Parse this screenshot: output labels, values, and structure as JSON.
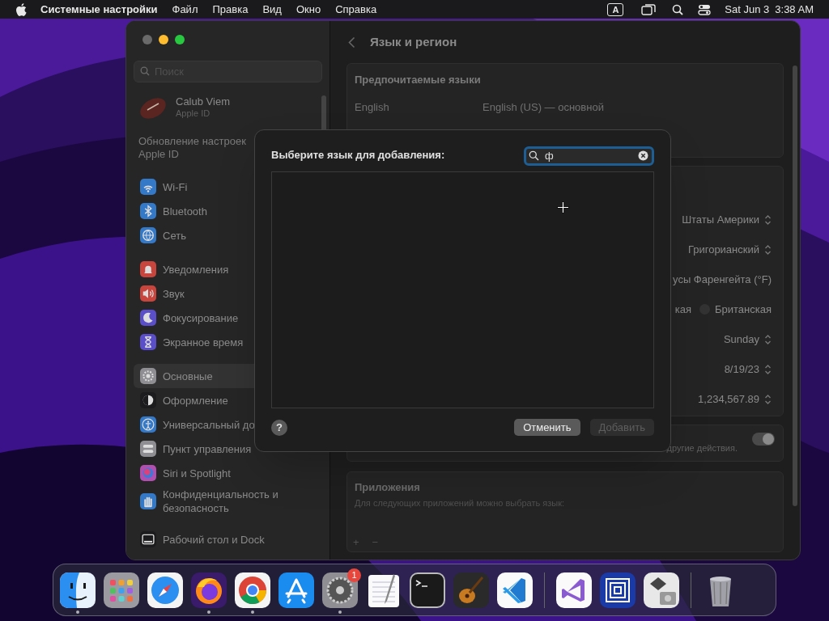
{
  "menu_bar": {
    "app": "Системные настройки",
    "menus": [
      "Файл",
      "Правка",
      "Вид",
      "Окно",
      "Справка"
    ],
    "input_source": "A",
    "date": "Sat Jun 3",
    "time": "3:38 AM"
  },
  "window": {
    "title": "Язык и регион",
    "sidebar": {
      "search": {
        "placeholder": "Поиск"
      },
      "account": {
        "name": "Calub Viem",
        "subtitle": "Apple ID"
      },
      "notice": "Обновление настроек Apple ID",
      "groups": [
        {
          "items": [
            {
              "kind": "wifi",
              "label": "Wi-Fi",
              "color": "#3478c8",
              "selected": false
            },
            {
              "kind": "bluetooth",
              "label": "Bluetooth",
              "color": "#3478c8",
              "selected": false
            },
            {
              "kind": "network",
              "label": "Сеть",
              "color": "#3478c8",
              "selected": false
            }
          ]
        },
        {
          "items": [
            {
              "kind": "bell",
              "label": "Уведомления",
              "color": "#c8453e",
              "selected": false
            },
            {
              "kind": "speaker",
              "label": "Звук",
              "color": "#c8453e",
              "selected": false
            },
            {
              "kind": "moon",
              "label": "Фокусирование",
              "color": "#5a4fc8",
              "selected": false
            },
            {
              "kind": "hourglass",
              "label": "Экранное время",
              "color": "#5a4fc8",
              "selected": false
            }
          ]
        },
        {
          "items": [
            {
              "kind": "gear",
              "label": "Основные",
              "color": "#8e8e93",
              "selected": true
            },
            {
              "kind": "contrast",
              "label": "Оформление",
              "color": "#1c1c1e",
              "selected": false
            },
            {
              "kind": "accessibility",
              "label": "Универсальный до",
              "color": "#3478c8",
              "selected": false
            },
            {
              "kind": "toggles",
              "label": "Пункт управления",
              "color": "#8e8e93",
              "selected": false
            },
            {
              "kind": "orb",
              "label": "Siri и Spotlight",
              "color": "#b04fb0",
              "selected": false
            },
            {
              "kind": "hand",
              "label": "Конфиденциальность и безопасность",
              "color": "#3478c8",
              "selected": false
            }
          ]
        },
        {
          "items": [
            {
              "kind": "dock",
              "label": "Рабочий стол и Dock",
              "color": "#1c1c1e",
              "selected": false
            }
          ]
        }
      ]
    },
    "preferred_languages": {
      "heading": "Предпочитаемые языки",
      "rows": [
        {
          "language": "English",
          "detail": "English (US) — основной"
        }
      ]
    },
    "region_rows": [
      {
        "kind": "popup",
        "value": "Штаты Америки"
      },
      {
        "kind": "popup",
        "value": "Григорианский"
      },
      {
        "kind": "text",
        "value": "усы Фаренгейта (°F)"
      },
      {
        "kind": "radio",
        "options": [
          {
            "label": "кая"
          },
          {
            "label": "Британская",
            "selected": false
          }
        ]
      },
      {
        "kind": "popup",
        "value": "Sunday"
      },
      {
        "kind": "popup",
        "value": "8/19/23"
      },
      {
        "kind": "popup",
        "value": "1,234,567.89"
      }
    ],
    "live_text": {
      "description": "другие действия.",
      "on": true
    },
    "applications": {
      "heading": "Приложения",
      "description": "Для следующих приложений можно выбрать язык:",
      "add": "+",
      "remove": "−"
    }
  },
  "dialog": {
    "title": "Выберите язык для добавления:",
    "search": {
      "value": "ф"
    },
    "help": "?",
    "buttons": [
      {
        "label": "Отменить",
        "disabled": false
      },
      {
        "label": "Добавить",
        "disabled": true
      }
    ]
  },
  "dock": [
    {
      "kind": "finder",
      "running": true
    },
    {
      "kind": "launchpad",
      "running": false
    },
    {
      "kind": "safari",
      "running": false
    },
    {
      "kind": "firefox",
      "running": true
    },
    {
      "kind": "chrome",
      "running": true
    },
    {
      "kind": "appstore",
      "running": false
    },
    {
      "kind": "settings",
      "running": true,
      "badge": "1"
    },
    {
      "kind": "textedit",
      "running": false
    },
    {
      "kind": "terminal",
      "running": false
    },
    {
      "kind": "garageband",
      "running": false
    },
    {
      "kind": "vscode",
      "running": false,
      "separator_after": true
    },
    {
      "kind": "visualstudio",
      "running": false
    },
    {
      "kind": "squares",
      "running": false
    },
    {
      "kind": "diskutil",
      "running": false,
      "separator_after": true
    },
    {
      "kind": "trash",
      "running": false
    }
  ]
}
